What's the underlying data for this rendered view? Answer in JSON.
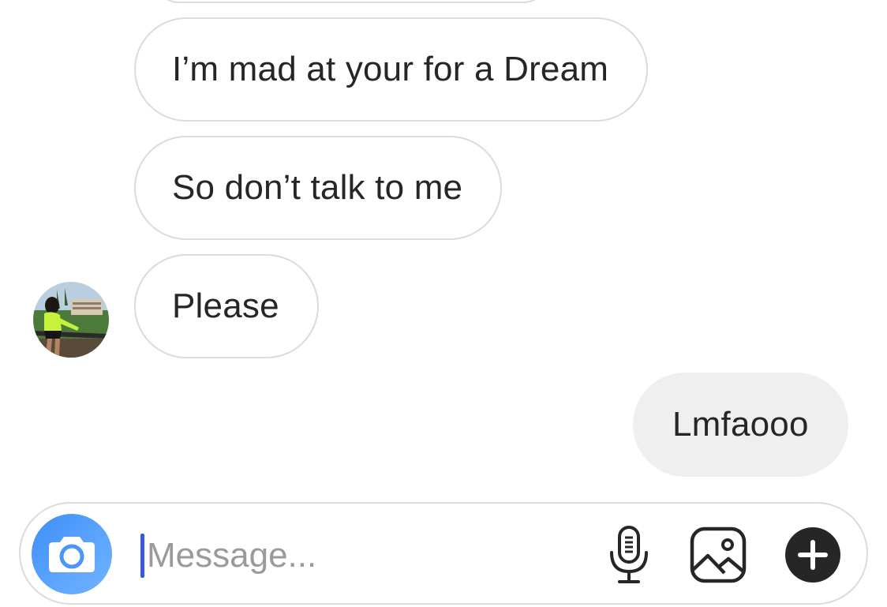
{
  "thread": {
    "messages": [
      {
        "sender": "them",
        "text": "I’m mad at your for a Dream"
      },
      {
        "sender": "them",
        "text": "So don’t talk to me"
      },
      {
        "sender": "them",
        "text": "Please"
      },
      {
        "sender": "me",
        "text": "Lmfaooo"
      }
    ]
  },
  "composer": {
    "placeholder": "Message...",
    "value": ""
  },
  "icons": {
    "camera": "camera-icon",
    "mic": "microphone-icon",
    "gallery": "image-gallery-icon",
    "add": "plus-circle-icon"
  },
  "colors": {
    "camera_button": "#3d8ef6",
    "incoming_border": "#dbdbdb",
    "outgoing_fill": "#efefef",
    "caret": "#3a5bd9"
  }
}
